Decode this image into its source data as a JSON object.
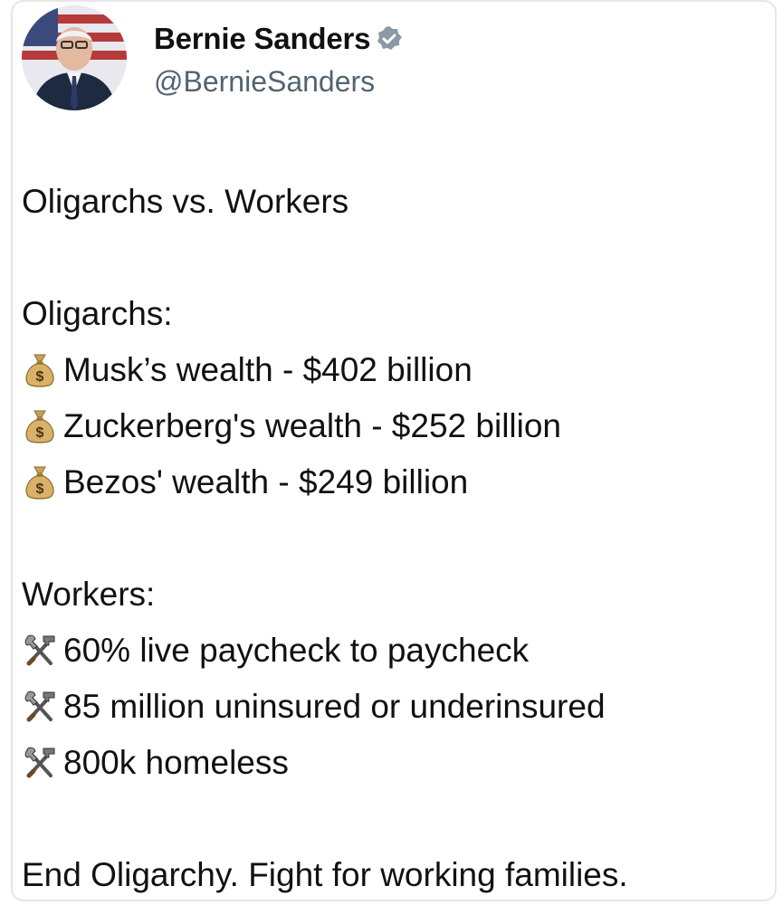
{
  "post": {
    "author_name": "Bernie Sanders",
    "author_handle": "@BernieSanders",
    "avatar_icon": "avatar-photo",
    "verified_icon": "verified-badge-icon",
    "title": "Oligarchs vs. Workers",
    "oligarchs_heading": "Oligarchs:",
    "oligarchs": [
      {
        "icon": "money-bag-icon",
        "text": "Musk’s wealth - $402 billion"
      },
      {
        "icon": "money-bag-icon",
        "text": "Zuckerberg's wealth - $252 billion"
      },
      {
        "icon": "money-bag-icon",
        "text": "Bezos' wealth - $249 billion"
      }
    ],
    "workers_heading": "Workers:",
    "workers": [
      {
        "icon": "hammer-wrench-icon",
        "text": "60% live paycheck to paycheck"
      },
      {
        "icon": "hammer-wrench-icon",
        "text": "85 million uninsured or underinsured"
      },
      {
        "icon": "hammer-wrench-icon",
        "text": "800k homeless"
      }
    ],
    "closing": "End Oligarchy. Fight for working families."
  },
  "colors": {
    "text": "#111111",
    "handle": "#536471",
    "verified": "#8b98a5",
    "card_border": "#e6e6e6"
  }
}
